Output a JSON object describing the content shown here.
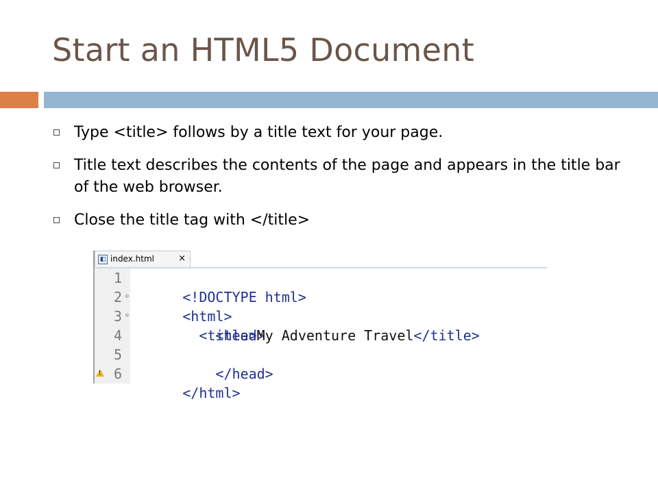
{
  "slide": {
    "title": "Start an HTML5 Document",
    "bullets": [
      "Type <title> follows by a title text for your page.",
      "Title text describes the contents of the page and appears in the title bar of the web browser.",
      "Close the title tag with </title>"
    ]
  },
  "editor": {
    "tab": {
      "label": "index.html",
      "close": "×",
      "icon": "html-file-icon"
    },
    "lines": [
      {
        "num": "1",
        "fold": "",
        "warn": false,
        "tag_open": "<!DOCTYPE html>",
        "text": "",
        "tag_close": ""
      },
      {
        "num": "2",
        "fold": "⊖",
        "warn": false,
        "tag_open": "<html>",
        "text": "",
        "tag_close": ""
      },
      {
        "num": "3",
        "fold": "⊖",
        "warn": false,
        "tag_open": "    <head>",
        "text": "",
        "tag_close": ""
      },
      {
        "num": "4",
        "fold": "",
        "warn": false,
        "tag_open": "        <title>",
        "text": "My Adventure Travel",
        "tag_close": "</title>"
      },
      {
        "num": "5",
        "fold": "",
        "warn": false,
        "tag_open": "    </head>",
        "text": "",
        "tag_close": ""
      },
      {
        "num": "6",
        "fold": "",
        "warn": true,
        "tag_open": "</html>",
        "text": "",
        "tag_close": ""
      }
    ]
  },
  "colors": {
    "title": "#6b5549",
    "accent_orange": "#dd8047",
    "accent_blue": "#94b6d2",
    "tag_blue": "#1f2f8f"
  }
}
